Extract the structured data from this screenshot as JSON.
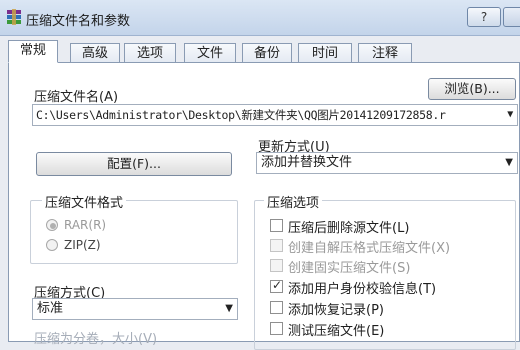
{
  "window": {
    "title": "压缩文件名和参数",
    "help_label": "?"
  },
  "tabs": [
    "常规",
    "高级",
    "选项",
    "文件",
    "备份",
    "时间",
    "注释"
  ],
  "archive_name": {
    "label": "压缩文件名(A)",
    "browse_label": "浏览(B)...",
    "value": "C:\\Users\\Administrator\\Desktop\\新建文件夹\\QQ图片20141209172858.r"
  },
  "update_mode": {
    "label": "更新方式(U)",
    "value": "添加并替换文件"
  },
  "profile_button": "配置(F)...",
  "archive_format": {
    "title": "压缩文件格式",
    "options": [
      {
        "label": "RAR(R)",
        "selected": true,
        "disabled": true
      },
      {
        "label": "ZIP(Z)",
        "selected": false,
        "disabled": true
      }
    ]
  },
  "compression_method": {
    "label": "压缩方式(C)",
    "value": "标准"
  },
  "split_volumes": {
    "label": "压缩为分卷，大小(V)"
  },
  "archiving_options": {
    "title": "压缩选项",
    "items": [
      {
        "label": "压缩后删除源文件(L)",
        "checked": false,
        "disabled": false
      },
      {
        "label": "创建自解压格式压缩文件(X)",
        "checked": false,
        "disabled": true
      },
      {
        "label": "创建固实压缩文件(S)",
        "checked": false,
        "disabled": true
      },
      {
        "label": "添加用户身份校验信息(T)",
        "checked": true,
        "disabled": false
      },
      {
        "label": "添加恢复记录(P)",
        "checked": false,
        "disabled": false
      },
      {
        "label": "测试压缩文件(E)",
        "checked": false,
        "disabled": false
      }
    ]
  },
  "colors": {
    "titlebar": "#c3d4ea",
    "dialog_bg": "#ffffff",
    "disabled_text": "#9a9a9a"
  }
}
